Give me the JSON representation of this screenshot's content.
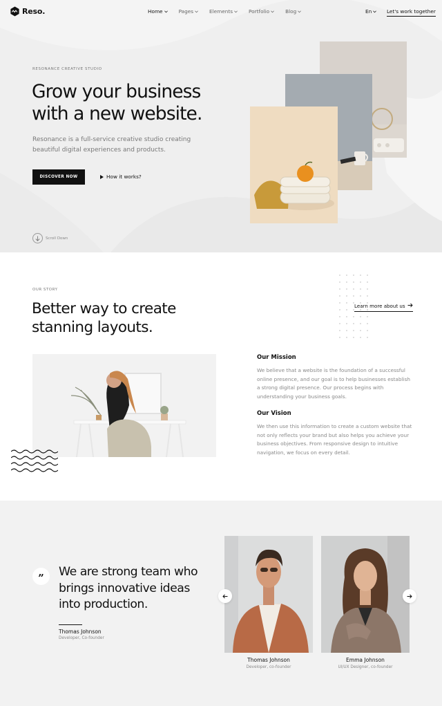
{
  "brand": {
    "name": "Reso."
  },
  "nav": {
    "items": [
      {
        "label": "Home",
        "active": true
      },
      {
        "label": "Pages",
        "active": false
      },
      {
        "label": "Elements",
        "active": false
      },
      {
        "label": "Portfolio",
        "active": false
      },
      {
        "label": "Blog",
        "active": false
      }
    ],
    "language": "En",
    "cta": "Let's work together"
  },
  "hero": {
    "eyebrow": "RESONANCE CREATIVE STUDIO",
    "title_line1": "Grow your business",
    "title_line2": "with a new website.",
    "subtitle_line1": "Resonance is a full-service creative studio creating",
    "subtitle_line2": "beautiful digital experiences and products.",
    "primary_button": "DISCOVER NOW",
    "secondary_link": "How it works?",
    "scroll_label": "Scroll Down"
  },
  "story": {
    "label": "OUR STORY",
    "title_line1": "Better way to create",
    "title_line2": "stanning layouts.",
    "learn_more": "Learn more about us",
    "mission_title": "Our Mission",
    "mission_text": "We believe that a website is the foundation of a successful online presence, and our goal is to help businesses establish a strong digital presence. Our process begins with understanding your business goals.",
    "vision_title": "Our Vision",
    "vision_text": "We then use this information to create a custom website that not only reflects your brand but also helps you achieve your business objectives. From responsive design to intuitive navigation, we focus on every detail."
  },
  "team": {
    "quote_mark": "”",
    "quote_line1": "We are strong team who",
    "quote_line2": "brings innovative ideas",
    "quote_line3": "into production.",
    "author_name": "Thomas Johnson",
    "author_role": "Developer, Co-founder",
    "members": [
      {
        "name": "Thomas Johnson",
        "role": "Developer, co-founder"
      },
      {
        "name": "Emma Johnson",
        "role": "UI/UX Designer, co-founder"
      }
    ]
  },
  "colors": {
    "text": "#111111",
    "muted": "#888888",
    "hero_bg": "#efefef",
    "team_bg": "#f2f2f2",
    "button_bg": "#111111"
  }
}
